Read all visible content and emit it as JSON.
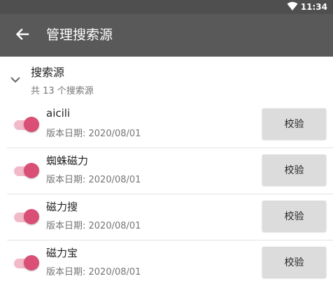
{
  "status_bar": {
    "time": "11:34",
    "icons": [
      "wifi-icon"
    ]
  },
  "toolbar": {
    "back_icon": "arrow-left-icon",
    "title": "管理搜索源"
  },
  "group": {
    "title": "搜索源",
    "subtitle": "共 13 个搜索源",
    "icon": "chevron-down-icon"
  },
  "sources": [
    {
      "name": "aicili",
      "date": "版本日期: 2020/08/01",
      "enabled": true,
      "verify_label": "校验"
    },
    {
      "name": "蜘蛛磁力",
      "date": "版本日期: 2020/08/01",
      "enabled": true,
      "verify_label": "校验"
    },
    {
      "name": "磁力搜",
      "date": "版本日期: 2020/08/01",
      "enabled": true,
      "verify_label": "校验"
    },
    {
      "name": "磁力宝",
      "date": "版本日期: 2020/08/01",
      "enabled": true,
      "verify_label": "校验"
    }
  ],
  "colors": {
    "toolbar": "#595959",
    "status_bar": "#4f4f4f",
    "accent": "#d94f76",
    "toggle_track": "#f2b9c9",
    "button": "#dcdcdc"
  }
}
